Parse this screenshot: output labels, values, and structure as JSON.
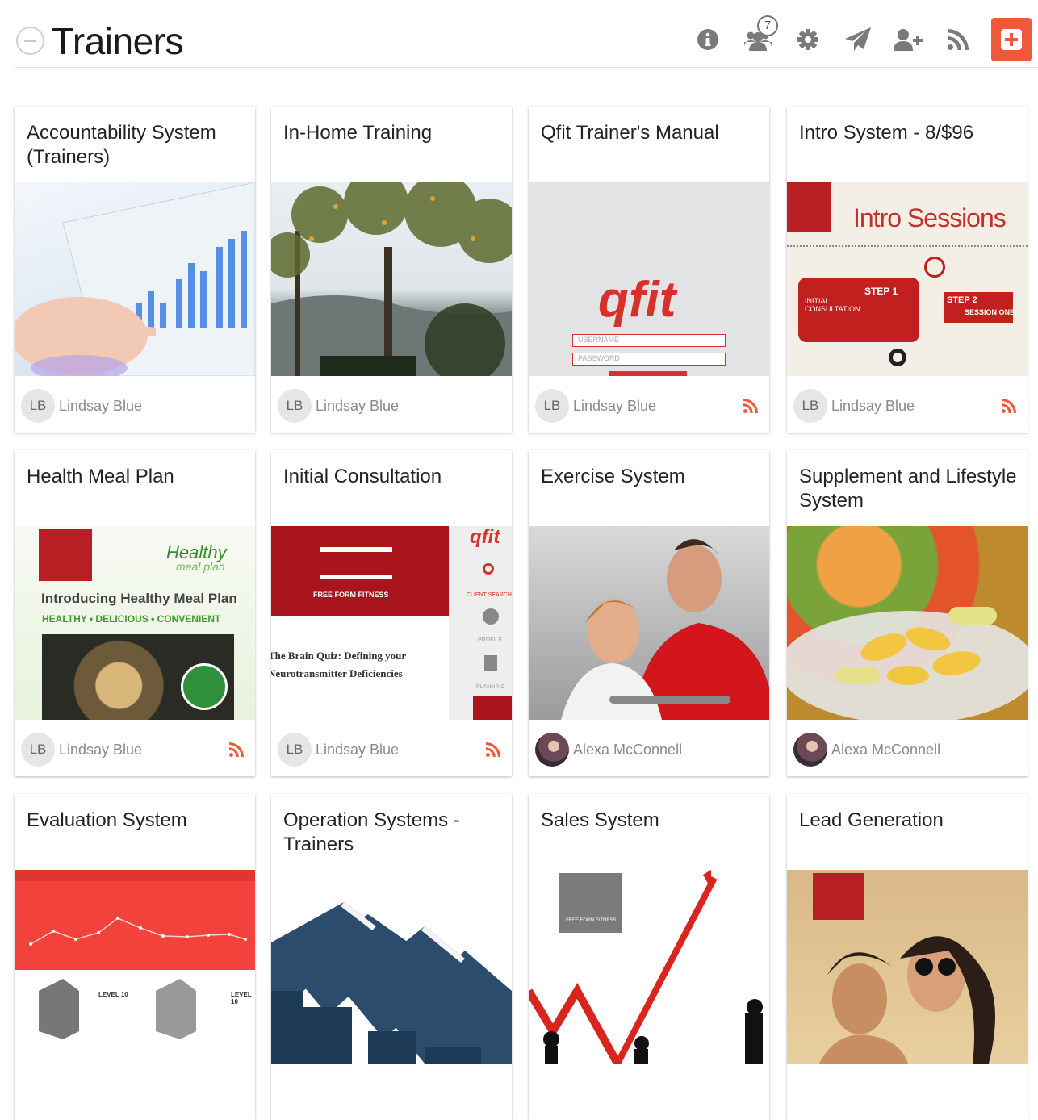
{
  "header": {
    "title": "Trainers",
    "members_count": "7",
    "icons": [
      "info-icon",
      "users-icon",
      "gear-icon",
      "paper-plane-icon",
      "add-user-icon",
      "rss-icon",
      "plus-square-icon"
    ]
  },
  "colors": {
    "accent": "#f0583c",
    "icon_gray": "#7a7a7a"
  },
  "cards": [
    {
      "title": "Accountability System (Trainers)",
      "author_initials": "LB",
      "author": "Lindsay Blue",
      "rss": false
    },
    {
      "title": "In-Home Training",
      "author_initials": "LB",
      "author": "Lindsay Blue",
      "rss": false
    },
    {
      "title": "Qfit Trainer's Manual",
      "author_initials": "LB",
      "author": "Lindsay Blue",
      "rss": true,
      "image_text": {
        "brand": "qfit",
        "username": "USERNAME",
        "password": "PASSWORD"
      }
    },
    {
      "title": "Intro System - 8/$96",
      "author_initials": "LB",
      "author": "Lindsay Blue",
      "rss": true,
      "image_text": {
        "heading": "Intro Sessions",
        "step1": "STEP 1",
        "step1_sub": "INITIAL CONSULTATION",
        "step2": "STEP 2",
        "step2_sub": "SESSION ONE"
      }
    },
    {
      "title": "Health Meal Plan",
      "author_initials": "LB",
      "author": "Lindsay Blue",
      "rss": true,
      "image_text": {
        "brand": "Healthy",
        "brand_sub": "meal plan",
        "headline": "Introducing Healthy Meal Plan",
        "tagline": "HEALTHY • DELICIOUS • CONVENIENT"
      }
    },
    {
      "title": "Initial Consultation",
      "author_initials": "LB",
      "author": "Lindsay Blue",
      "rss": true,
      "image_text": {
        "brand": "FREE FORM FITNESS",
        "quiz": "The Brain Quiz: Defining your Neurotransmitter Deficiencies",
        "qfit": "qfit",
        "client_search": "CLIENT SEARCH",
        "profile": "PROFILE",
        "planning": "PLANNING"
      }
    },
    {
      "title": "Exercise System",
      "author_initials": "",
      "author": "Alexa McConnell",
      "rss": false
    },
    {
      "title": "Supplement and Lifestyle System",
      "author_initials": "",
      "author": "Alexa McConnell",
      "rss": false
    },
    {
      "title": "Evaluation System",
      "author_initials": "",
      "author": "",
      "rss": false,
      "image_text": {
        "level_a": "LEVEL 10",
        "level_b": "LEVEL 10"
      }
    },
    {
      "title": "Operation Systems - Trainers",
      "author_initials": "",
      "author": "",
      "rss": false
    },
    {
      "title": "Sales System",
      "author_initials": "",
      "author": "",
      "rss": false,
      "image_text": {
        "brand": "FREE FORM FITNESS"
      }
    },
    {
      "title": "Lead Generation",
      "author_initials": "",
      "author": "",
      "rss": false
    }
  ]
}
